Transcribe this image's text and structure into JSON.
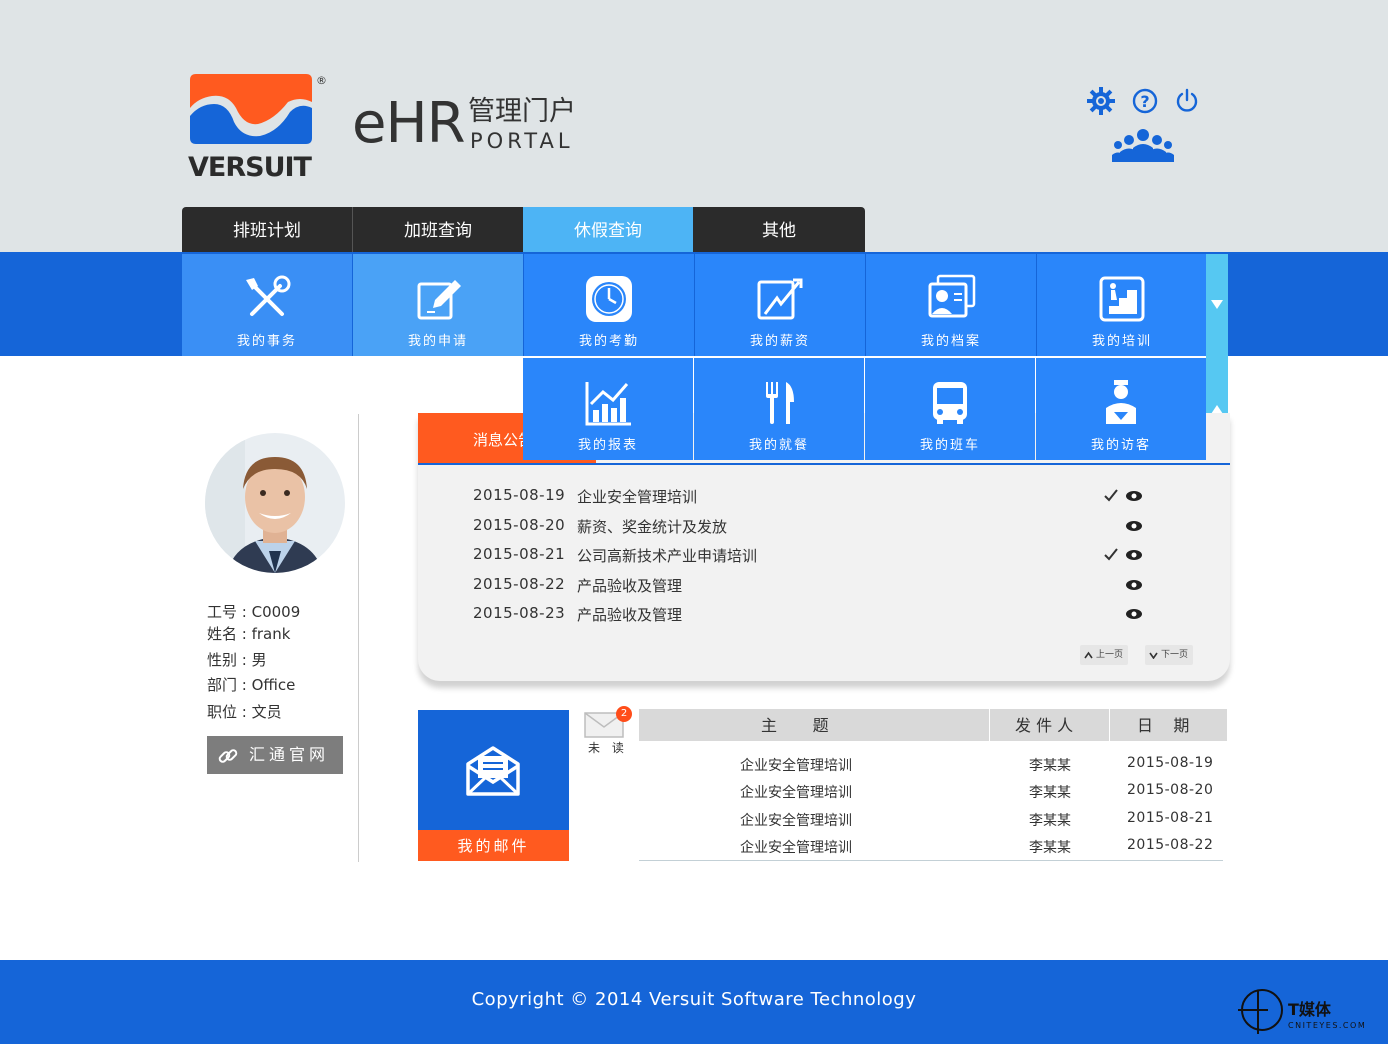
{
  "brand": {
    "logo_text": "VERSUIT",
    "ehr": "eHR",
    "cn": "管理门户",
    "en": "PORTAL"
  },
  "header_icons": [
    "gear-icon",
    "help-icon",
    "power-icon",
    "team-icon"
  ],
  "tabs": [
    {
      "label": "排班计划",
      "active": false
    },
    {
      "label": "加班查询",
      "active": false
    },
    {
      "label": "休假查询",
      "active": true
    },
    {
      "label": "其他",
      "active": false
    }
  ],
  "menu_row1": [
    {
      "label": "我的事务",
      "icon": "tools-icon",
      "bg": "#3a8ff5"
    },
    {
      "label": "我的申请",
      "icon": "edit-icon",
      "bg": "#4aa2f6"
    },
    {
      "label": "我的考勤",
      "icon": "clock-icon",
      "bg": "#2a86fa"
    },
    {
      "label": "我的薪资",
      "icon": "salary-icon",
      "bg": "#2a86fa"
    },
    {
      "label": "我的档案",
      "icon": "profile-card-icon",
      "bg": "#2a86fa"
    },
    {
      "label": "我的培训",
      "icon": "training-icon",
      "bg": "#2a86fa"
    }
  ],
  "menu_row2": [
    {
      "label": "我的报表",
      "icon": "chart-icon"
    },
    {
      "label": "我的就餐",
      "icon": "dining-icon"
    },
    {
      "label": "我的班车",
      "icon": "bus-icon"
    },
    {
      "label": "我的访客",
      "icon": "visitor-icon"
    }
  ],
  "user": {
    "id": "工号 : C0009",
    "name": "姓名 : frank",
    "gender": "性别 : 男",
    "dept": "部门 : Office",
    "position": "职位 : 文员",
    "official_link": "汇通官网"
  },
  "news": {
    "tab": "消息公告",
    "items": [
      {
        "date": "2015-08-19",
        "title": "企业安全管理培训",
        "checked": true
      },
      {
        "date": "2015-08-20",
        "title": "薪资、奖金统计及发放",
        "checked": false
      },
      {
        "date": "2015-08-21",
        "title": "公司高新技术产业申请培训",
        "checked": true
      },
      {
        "date": "2015-08-22",
        "title": "产品验收及管理",
        "checked": false
      },
      {
        "date": "2015-08-23",
        "title": "产品验收及管理",
        "checked": false
      }
    ],
    "prev": "上一页",
    "next": "下一页"
  },
  "mail": {
    "label": "我的邮件",
    "unread_label": "未 读",
    "unread_count": "2",
    "headers": {
      "subject": "主       题",
      "sender": "发 件 人",
      "date": "日    期"
    },
    "rows": [
      {
        "subject": "企业安全管理培训",
        "sender": "李某某",
        "date": "2015-08-19"
      },
      {
        "subject": "企业安全管理培训",
        "sender": "李某某",
        "date": "2015-08-20"
      },
      {
        "subject": "企业安全管理培训",
        "sender": "李某某",
        "date": "2015-08-21"
      },
      {
        "subject": "企业安全管理培训",
        "sender": "李某某",
        "date": "2015-08-22"
      }
    ]
  },
  "footer": {
    "copyright": "Copyright ©  2014 Versuit Software Technology"
  },
  "watermark": {
    "cn": "T媒体",
    "en": "CNITEYES.COM"
  },
  "colors": {
    "primary": "#1565d8",
    "accent": "#ff5a1f",
    "tab_active": "#4db4f5",
    "header_bg": "#dfe4e6"
  }
}
